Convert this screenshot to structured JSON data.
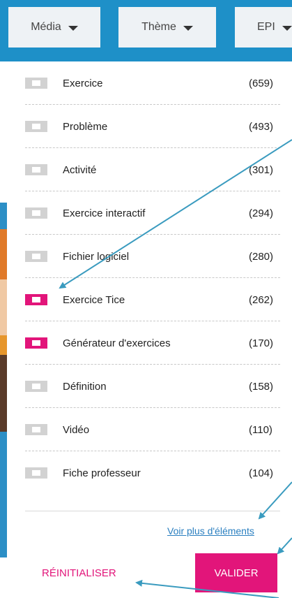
{
  "filters": {
    "media_label": "Média",
    "theme_label": "Thème",
    "epi_label": "EPI"
  },
  "items": [
    {
      "label": "Exercice",
      "count": "(659)",
      "checked": false
    },
    {
      "label": "Problème",
      "count": "(493)",
      "checked": false
    },
    {
      "label": "Activité",
      "count": "(301)",
      "checked": false
    },
    {
      "label": "Exercice interactif",
      "count": "(294)",
      "checked": false
    },
    {
      "label": "Fichier logiciel",
      "count": "(280)",
      "checked": false
    },
    {
      "label": "Exercice Tice",
      "count": "(262)",
      "checked": true
    },
    {
      "label": "Générateur d'exercices",
      "count": "(170)",
      "checked": true
    },
    {
      "label": "Définition",
      "count": "(158)",
      "checked": false
    },
    {
      "label": "Vidéo",
      "count": "(110)",
      "checked": false
    },
    {
      "label": "Fiche professeur",
      "count": "(104)",
      "checked": false
    }
  ],
  "more_link": "Voir plus d'éléments",
  "reset_label": "RÉINITIALISER",
  "validate_label": "VALIDER",
  "colors": {
    "accent": "#e2157a",
    "header": "#1e90c8",
    "annotation_arrow": "#3a9bbf"
  }
}
